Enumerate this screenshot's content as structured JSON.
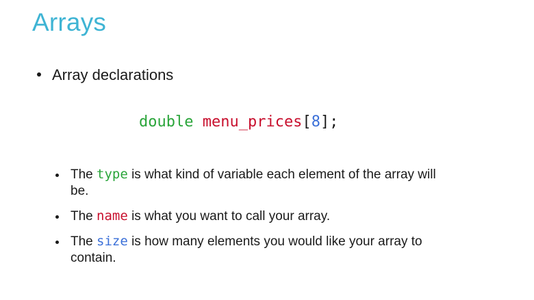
{
  "title": "Arrays",
  "main_bullet": "Array declarations",
  "code": {
    "type": "double",
    "name": "menu_prices",
    "open_bracket": "[",
    "size": "8",
    "close_bracket": "];"
  },
  "items": [
    {
      "prefix": "The ",
      "keyword": "type",
      "suffix": " is what kind of variable each element of the array will be."
    },
    {
      "prefix": "The ",
      "keyword": "name",
      "suffix": " is what you want to call your array."
    },
    {
      "prefix": "The ",
      "keyword": "size",
      "suffix": " is how many elements you would like your array to contain."
    }
  ],
  "colors": {
    "title": "#3fb4d4",
    "type": "#2aa53a",
    "name": "#c8102e",
    "size": "#3a6fd8"
  }
}
